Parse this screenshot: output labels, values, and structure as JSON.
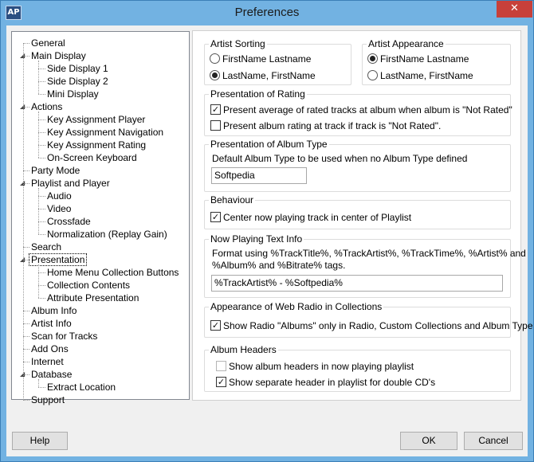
{
  "window": {
    "title": "Preferences",
    "app_icon_text": "AP",
    "close_glyph": "✕"
  },
  "tree": {
    "items": [
      {
        "label": "General",
        "level": 0,
        "expander": ""
      },
      {
        "label": "Main Display",
        "level": 0,
        "expander": "collapse"
      },
      {
        "label": "Side Display 1",
        "level": 1,
        "expander": ""
      },
      {
        "label": "Side Display 2",
        "level": 1,
        "expander": ""
      },
      {
        "label": "Mini Display",
        "level": 1,
        "expander": ""
      },
      {
        "label": "Actions",
        "level": 0,
        "expander": "collapse"
      },
      {
        "label": "Key Assignment Player",
        "level": 1,
        "expander": ""
      },
      {
        "label": "Key Assignment Navigation",
        "level": 1,
        "expander": ""
      },
      {
        "label": "Key Assignment Rating",
        "level": 1,
        "expander": ""
      },
      {
        "label": "On-Screen Keyboard",
        "level": 1,
        "expander": ""
      },
      {
        "label": "Party Mode",
        "level": 0,
        "expander": ""
      },
      {
        "label": "Playlist and Player",
        "level": 0,
        "expander": "collapse"
      },
      {
        "label": "Audio",
        "level": 1,
        "expander": ""
      },
      {
        "label": "Video",
        "level": 1,
        "expander": ""
      },
      {
        "label": "Crossfade",
        "level": 1,
        "expander": ""
      },
      {
        "label": "Normalization (Replay Gain)",
        "level": 1,
        "expander": ""
      },
      {
        "label": "Search",
        "level": 0,
        "expander": ""
      },
      {
        "label": "Presentation",
        "level": 0,
        "expander": "collapse",
        "selected": true
      },
      {
        "label": "Home Menu Collection Buttons",
        "level": 1,
        "expander": ""
      },
      {
        "label": "Collection Contents",
        "level": 1,
        "expander": ""
      },
      {
        "label": "Attribute Presentation",
        "level": 1,
        "expander": ""
      },
      {
        "label": "Album Info",
        "level": 0,
        "expander": ""
      },
      {
        "label": "Artist Info",
        "level": 0,
        "expander": ""
      },
      {
        "label": "Scan for Tracks",
        "level": 0,
        "expander": ""
      },
      {
        "label": "Add Ons",
        "level": 0,
        "expander": ""
      },
      {
        "label": "Internet",
        "level": 0,
        "expander": ""
      },
      {
        "label": "Database",
        "level": 0,
        "expander": "collapse"
      },
      {
        "label": "Extract Location",
        "level": 1,
        "expander": ""
      },
      {
        "label": "Support",
        "level": 0,
        "expander": ""
      }
    ]
  },
  "artist_sorting": {
    "title": "Artist Sorting",
    "option1": "FirstName Lastname",
    "option2": "LastName, FirstName",
    "selected": 2
  },
  "artist_appearance": {
    "title": "Artist Appearance",
    "option1": "FirstName Lastname",
    "option2": "LastName, FirstName",
    "selected": 1
  },
  "rating": {
    "title": "Presentation of Rating",
    "check1": "Present average of rated tracks at album when album is \"Not Rated\"",
    "check1_on": true,
    "check2": "Present album rating at track if track is \"Not Rated\".",
    "check2_on": false
  },
  "album_type": {
    "title": "Presentation of Album Type",
    "label": "Default Album Type to be used when no Album Type defined",
    "value": "Softpedia"
  },
  "behaviour": {
    "title": "Behaviour",
    "check1": "Center now playing track in center of Playlist",
    "check1_on": true
  },
  "now_playing": {
    "title": "Now Playing Text Info",
    "desc_line1": "Format using %TrackTitle%,  %TrackArtist%, %TrackTime%, %Artist% and",
    "desc_line2": "%Album% and %Bitrate% tags.",
    "value": "%TrackArtist% - %Softpedia%"
  },
  "web_radio": {
    "title": "Appearance of Web Radio in Collections",
    "check1": "Show Radio \"Albums\" only in Radio, Custom Collections and Album Type",
    "check1_on": true
  },
  "album_headers": {
    "title": "Album Headers",
    "check1": "Show album headers in now playing playlist",
    "check1_on": false,
    "check2": "Show separate header in playlist for double CD's",
    "check2_on": true
  },
  "buttons": {
    "help": "Help",
    "ok": "OK",
    "cancel": "Cancel"
  },
  "glyphs": {
    "check": "✓",
    "collapse": "◢"
  }
}
